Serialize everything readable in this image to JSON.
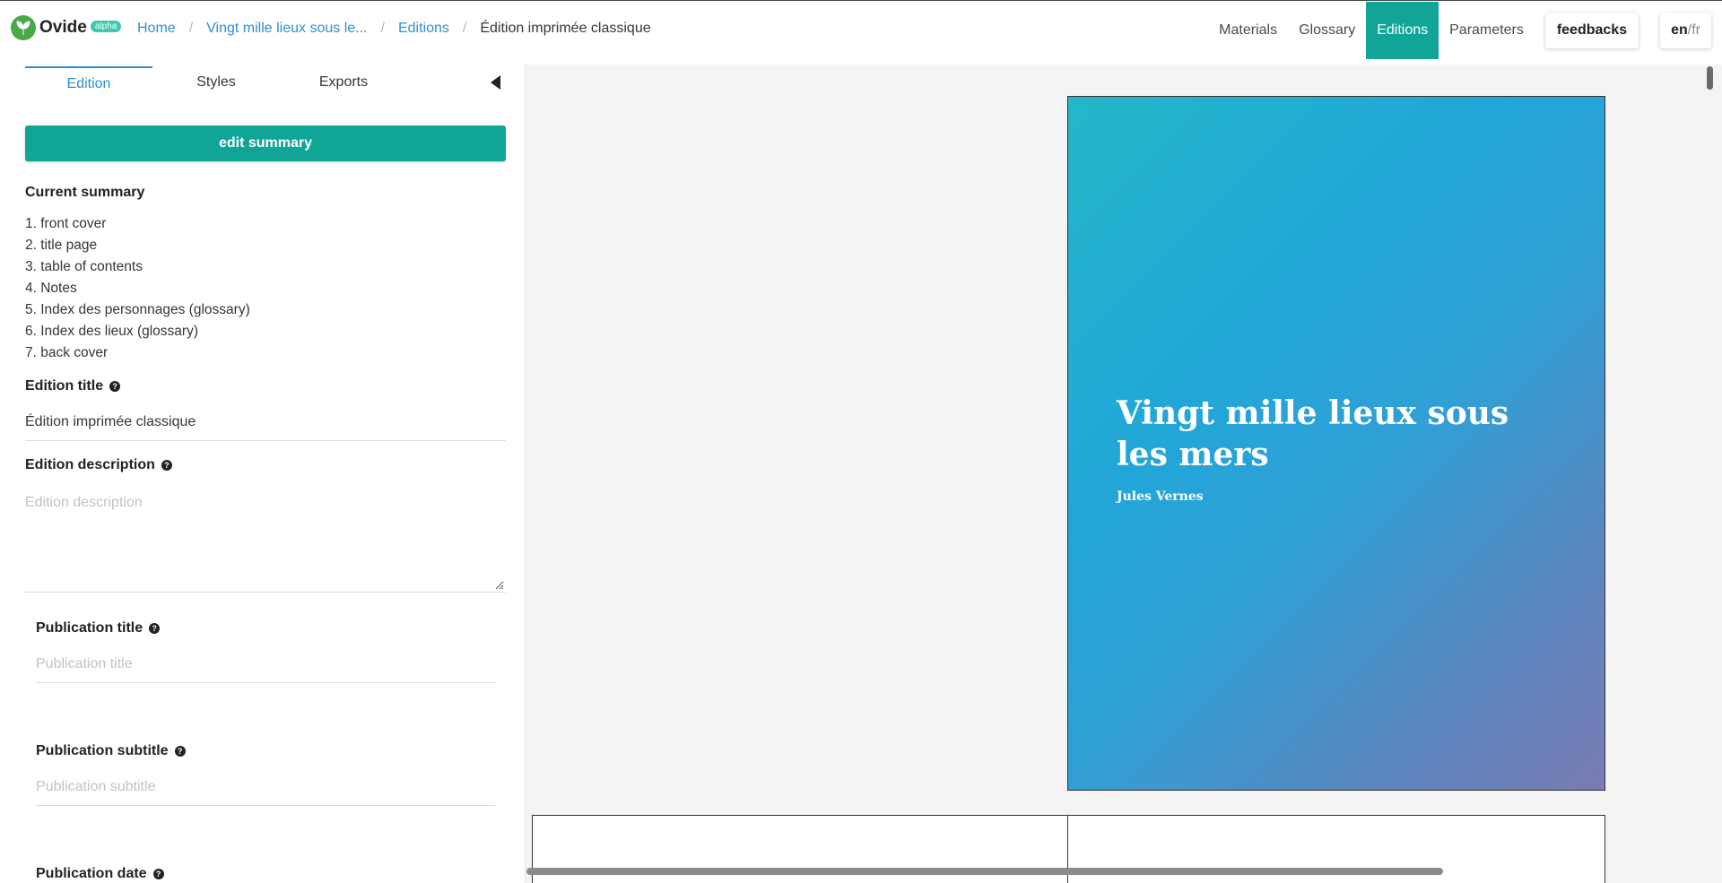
{
  "app": {
    "name": "Ovide",
    "badge": "alpha"
  },
  "breadcrumb": {
    "home": "Home",
    "story": "Vingt mille lieux sous le...",
    "editions": "Editions",
    "current": "Édition imprimée classique",
    "separator": "/"
  },
  "nav": {
    "materials": "Materials",
    "glossary": "Glossary",
    "editions": "Editions",
    "parameters": "Parameters",
    "feedbacks": "feedbacks",
    "lang_current": "en",
    "lang_sep": "/",
    "lang_other": "fr"
  },
  "tabs": {
    "edition": "Edition",
    "styles": "Styles",
    "exports": "Exports"
  },
  "edit_summary_label": "edit summary",
  "summary": {
    "heading": "Current summary",
    "items": [
      "1. front cover",
      "2. title page",
      "3. table of contents",
      "4. Notes",
      "5. Index des personnages (glossary)",
      "6. Index des lieux (glossary)",
      "7. back cover"
    ]
  },
  "fields": {
    "edition_title": {
      "label": "Edition title",
      "value": "Édition imprimée classique"
    },
    "edition_description": {
      "label": "Edition description",
      "placeholder": "Edition description"
    },
    "publication_title": {
      "label": "Publication title",
      "placeholder": "Publication title"
    },
    "publication_subtitle": {
      "label": "Publication subtitle",
      "placeholder": "Publication subtitle"
    },
    "publication_date": {
      "label": "Publication date"
    }
  },
  "help_glyph": "?",
  "cover": {
    "title": "Vingt mille lieux sous les mers",
    "author": "Jules Vernes"
  },
  "colors": {
    "accent": "#10a597",
    "link": "#2b8fd6",
    "brand_badge": "#3cc9b0"
  }
}
